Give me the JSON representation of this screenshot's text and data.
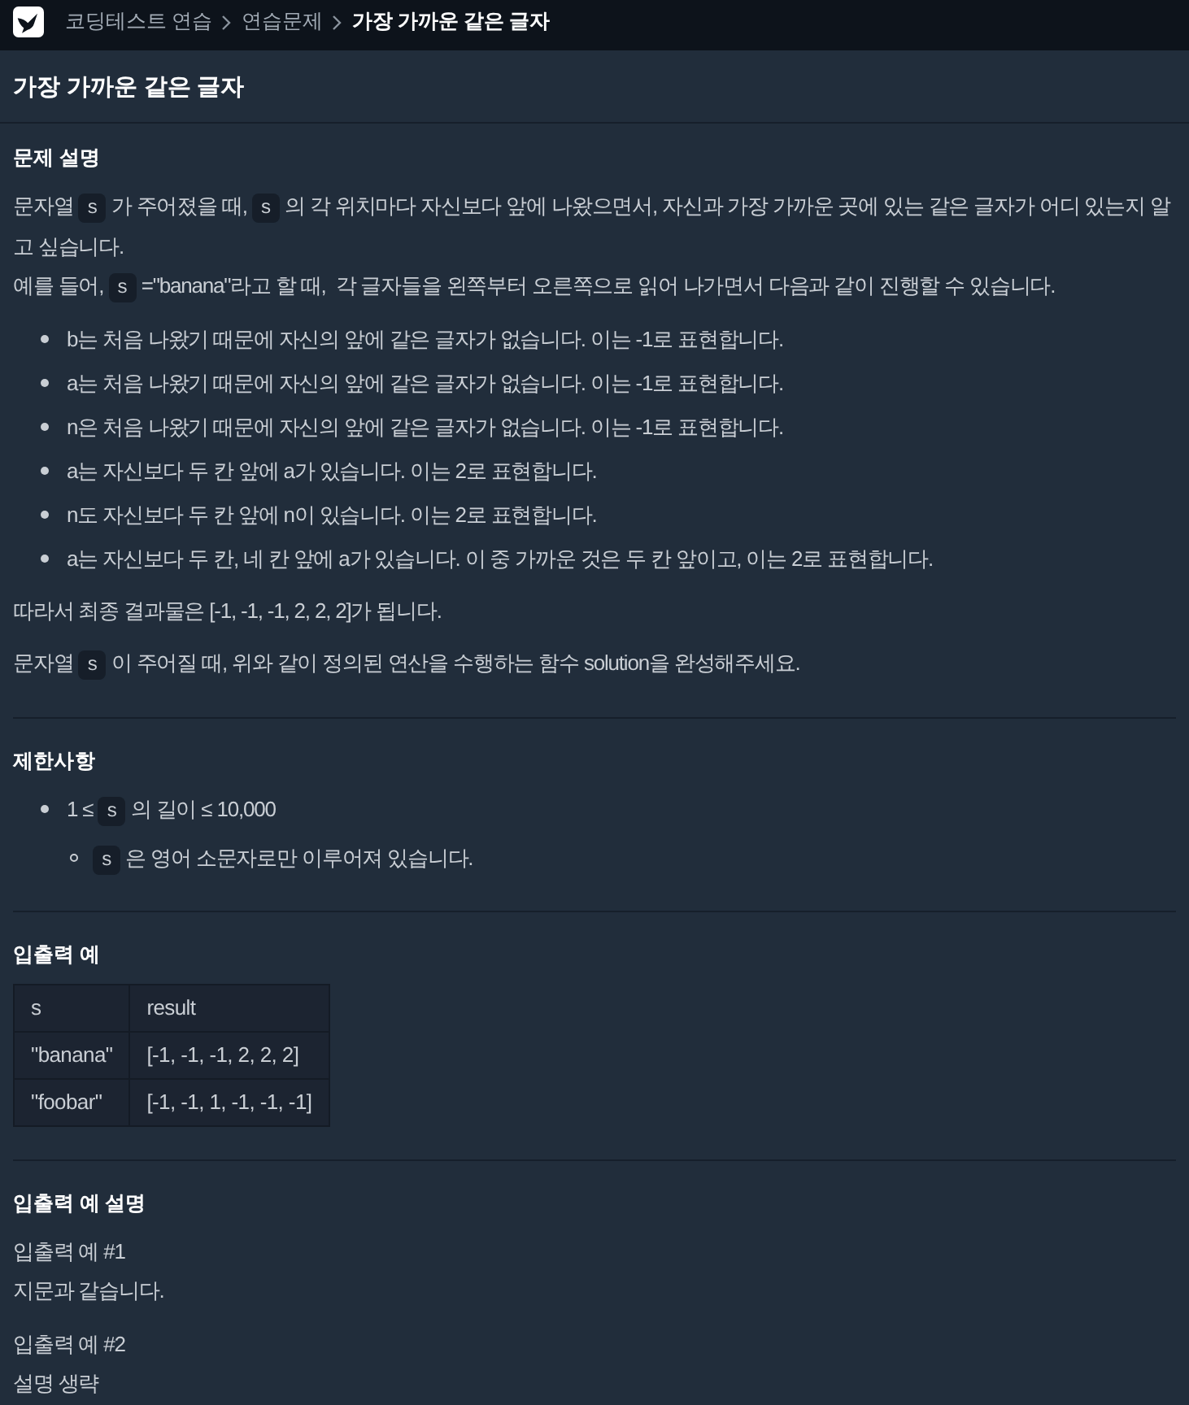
{
  "topbar": {
    "breadcrumbs": [
      {
        "label": "코딩테스트 연습",
        "current": false
      },
      {
        "label": "연습문제",
        "current": false
      },
      {
        "label": "가장 가까운 같은 글자",
        "current": true
      }
    ]
  },
  "title": "가장 가까운 같은 글자",
  "sections": [
    {
      "heading": "문제 설명",
      "blocks": [
        {
          "kind": "paragraph",
          "lines": [
            [
              {
                "kind": "text",
                "text": "문자열 "
              },
              {
                "kind": "code",
                "text": "s"
              },
              {
                "kind": "text",
                "text": " 가 주어졌을 때, "
              },
              {
                "kind": "code",
                "text": "s"
              },
              {
                "kind": "text",
                "text": " 의 각 위치마다 자신보다 앞에 나왔으면서, 자신과 가장 가까운 곳에 있는 같은 글자가 어디 있는지 알고 싶습니다."
              }
            ],
            [
              {
                "kind": "text",
                "text": "예를 들어, "
              },
              {
                "kind": "code",
                "text": "s"
              },
              {
                "kind": "text",
                "text": " =\"banana\"라고 할 때,  각 글자들을 왼쪽부터 오른쪽으로 읽어 나가면서 다음과 같이 진행할 수 있습니다."
              }
            ]
          ]
        },
        {
          "kind": "list",
          "items": [
            {
              "parts": [
                {
                  "kind": "text",
                  "text": "b는 처음 나왔기 때문에 자신의 앞에 같은 글자가 없습니다. 이는 -1로 표현합니다."
                }
              ]
            },
            {
              "parts": [
                {
                  "kind": "text",
                  "text": "a는 처음 나왔기 때문에 자신의 앞에 같은 글자가 없습니다. 이는 -1로 표현합니다."
                }
              ]
            },
            {
              "parts": [
                {
                  "kind": "text",
                  "text": "n은 처음 나왔기 때문에 자신의 앞에 같은 글자가 없습니다. 이는 -1로 표현합니다."
                }
              ]
            },
            {
              "parts": [
                {
                  "kind": "text",
                  "text": "a는 자신보다 두 칸 앞에 a가 있습니다. 이는 2로 표현합니다."
                }
              ]
            },
            {
              "parts": [
                {
                  "kind": "text",
                  "text": "n도 자신보다 두 칸 앞에 n이 있습니다. 이는 2로 표현합니다."
                }
              ]
            },
            {
              "parts": [
                {
                  "kind": "text",
                  "text": "a는 자신보다 두 칸, 네 칸 앞에 a가 있습니다. 이 중 가까운 것은 두 칸 앞이고, 이는 2로 표현합니다."
                }
              ]
            }
          ]
        },
        {
          "kind": "paragraph",
          "lines": [
            [
              {
                "kind": "text",
                "text": "따라서 최종 결과물은 [-1, -1, -1, 2, 2, 2]가 됩니다."
              }
            ]
          ]
        },
        {
          "kind": "paragraph",
          "lines": [
            [
              {
                "kind": "text",
                "text": "문자열 "
              },
              {
                "kind": "code",
                "text": "s"
              },
              {
                "kind": "text",
                "text": " 이 주어질 때, 위와 같이 정의된 연산을 수행하는 함수 solution을 완성해주세요."
              }
            ]
          ]
        }
      ]
    },
    {
      "heading": "제한사항",
      "blocks": [
        {
          "kind": "list",
          "items": [
            {
              "parts": [
                {
                  "kind": "text",
                  "text": "1 ≤ "
                },
                {
                  "kind": "code",
                  "text": "s"
                },
                {
                  "kind": "text",
                  "text": " 의 길이 ≤ 10,000"
                }
              ],
              "children": [
                {
                  "parts": [
                    {
                      "kind": "code",
                      "text": "s"
                    },
                    {
                      "kind": "text",
                      "text": " 은 영어 소문자로만 이루어져 있습니다."
                    }
                  ]
                }
              ]
            }
          ]
        }
      ]
    },
    {
      "heading": "입출력 예",
      "blocks": [
        {
          "kind": "table",
          "columns": [
            "s",
            "result"
          ],
          "rows": [
            [
              "\"banana\"",
              "[-1, -1, -1, 2, 2, 2]"
            ],
            [
              "\"foobar\"",
              "[-1, -1, 1, -1, -1, -1]"
            ]
          ]
        }
      ]
    },
    {
      "heading": "입출력 예 설명",
      "blocks": [
        {
          "kind": "paragraph",
          "lines": [
            [
              {
                "kind": "text",
                "text": "입출력 예 #1"
              }
            ],
            [
              {
                "kind": "text",
                "text": "지문과 같습니다."
              }
            ]
          ]
        },
        {
          "kind": "paragraph",
          "lines": [
            [
              {
                "kind": "text",
                "text": "입출력 예 #2"
              }
            ],
            [
              {
                "kind": "text",
                "text": "설명 생략"
              }
            ]
          ]
        }
      ]
    }
  ]
}
